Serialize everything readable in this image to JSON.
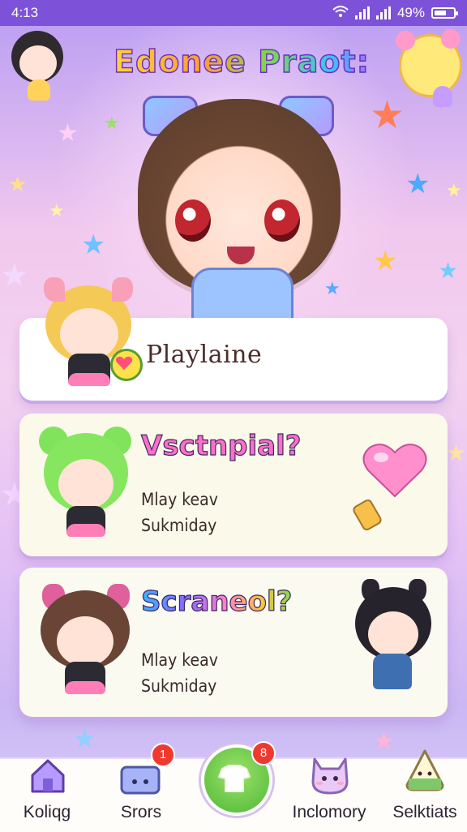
{
  "status_bar": {
    "time": "4:13",
    "battery_text": "49%"
  },
  "app": {
    "title": "Edonee Praot:"
  },
  "cards": [
    {
      "title": "Playlaine"
    },
    {
      "title": "Vsctnpial?",
      "lines": [
        "Mlay keav",
        "Sukmiday"
      ]
    },
    {
      "title": "Scraneol?",
      "lines": [
        "Mlay keav",
        "Sukmiday"
      ]
    }
  ],
  "bottom_nav": {
    "items": [
      {
        "label": "Koliqg",
        "icon": "home-icon"
      },
      {
        "label": "Srors",
        "icon": "box-icon",
        "badge": "1"
      },
      {
        "label": "",
        "icon": "shirt-icon",
        "badge": "8"
      },
      {
        "label": "Inclomory",
        "icon": "cat-icon"
      },
      {
        "label": "Selktiats",
        "icon": "onigiri-icon"
      }
    ]
  },
  "colors": {
    "status_bar": "#7d52d8",
    "accent_pink": "#ff6ec7",
    "badge_red": "#f0392e",
    "center_button": "#4fb836"
  }
}
